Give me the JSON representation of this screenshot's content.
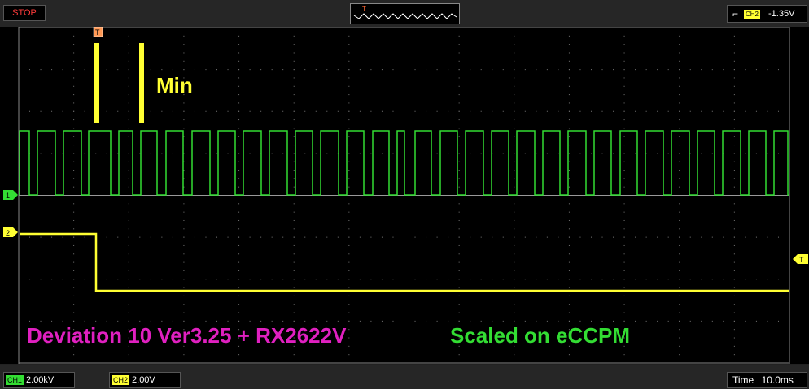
{
  "status": "STOP",
  "trigger": {
    "source": "CH2",
    "level": "-1.35V",
    "marker": "T"
  },
  "channels": [
    {
      "name": "CH1",
      "scale": "2.00kV",
      "marker": "1",
      "color": "#33dd33"
    },
    {
      "name": "CH2",
      "scale": "2.00V",
      "marker": "2",
      "color": "#ffff33"
    }
  ],
  "timebase": {
    "label": "Time",
    "value": "10.0ms"
  },
  "annotations": {
    "min_label": "Min",
    "left_caption": "Deviation 10 Ver3.25 + RX2622V",
    "right_caption": "Scaled on eCCPM"
  },
  "colors": {
    "ch1": "#33dd33",
    "ch2": "#ffff33",
    "caption_left": "#e020c0",
    "caption_right": "#33dd33",
    "status": "#ff3b3b"
  }
}
